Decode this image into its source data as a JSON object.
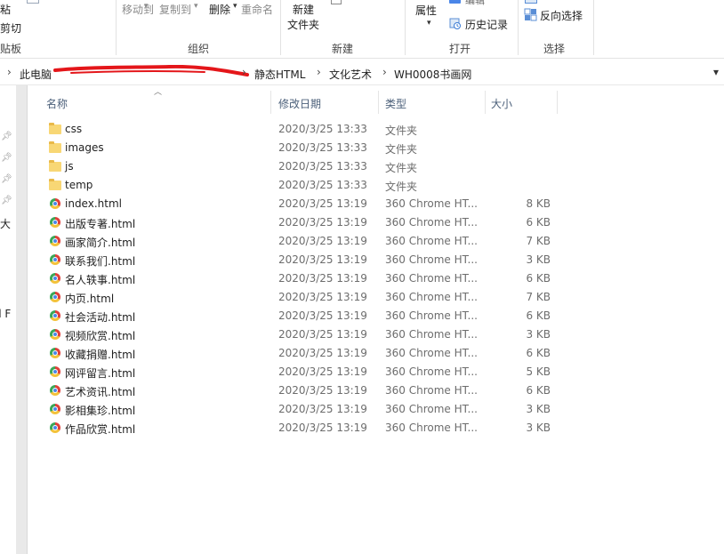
{
  "ribbon": {
    "clipboard": {
      "paste_clipped": "粘",
      "cut_clipped": "剪切",
      "group_clipped": "贴板"
    },
    "organize": {
      "move_to": "移动到",
      "copy_to": "复制到",
      "delete": "删除",
      "rename": "重命名",
      "group": "组织"
    },
    "new": {
      "new_folder_line1": "新建",
      "new_folder_line2": "文件夹",
      "group": "新建"
    },
    "open": {
      "properties": "属性",
      "edit_clipped": "编辑",
      "history": "历史记录",
      "group": "打开"
    },
    "select": {
      "invert": "反向选择",
      "group": "选择"
    }
  },
  "address": {
    "crumbs": [
      "此电脑",
      "静态HTML",
      "文化艺术",
      "WH0008书画网"
    ]
  },
  "columns": {
    "name": "名称",
    "date": "修改日期",
    "type": "类型",
    "size": "大小"
  },
  "nav": {
    "clip1": "大",
    "clip2": "d F"
  },
  "files": [
    {
      "name": "css",
      "date": "2020/3/25 13:33",
      "type": "文件夹",
      "size": "",
      "icon": "folder-icon"
    },
    {
      "name": "images",
      "date": "2020/3/25 13:33",
      "type": "文件夹",
      "size": "",
      "icon": "folder-icon"
    },
    {
      "name": "js",
      "date": "2020/3/25 13:33",
      "type": "文件夹",
      "size": "",
      "icon": "folder-icon"
    },
    {
      "name": "temp",
      "date": "2020/3/25 13:33",
      "type": "文件夹",
      "size": "",
      "icon": "folder-icon"
    },
    {
      "name": "index.html",
      "date": "2020/3/25 13:19",
      "type": "360 Chrome HT...",
      "size": "8 KB",
      "icon": "chrome-html-icon"
    },
    {
      "name": "出版专著.html",
      "date": "2020/3/25 13:19",
      "type": "360 Chrome HT...",
      "size": "6 KB",
      "icon": "chrome-html-icon"
    },
    {
      "name": "画家简介.html",
      "date": "2020/3/25 13:19",
      "type": "360 Chrome HT...",
      "size": "7 KB",
      "icon": "chrome-html-icon"
    },
    {
      "name": "联系我们.html",
      "date": "2020/3/25 13:19",
      "type": "360 Chrome HT...",
      "size": "3 KB",
      "icon": "chrome-html-icon"
    },
    {
      "name": "名人轶事.html",
      "date": "2020/3/25 13:19",
      "type": "360 Chrome HT...",
      "size": "6 KB",
      "icon": "chrome-html-icon"
    },
    {
      "name": "内页.html",
      "date": "2020/3/25 13:19",
      "type": "360 Chrome HT...",
      "size": "7 KB",
      "icon": "chrome-html-icon"
    },
    {
      "name": "社会活动.html",
      "date": "2020/3/25 13:19",
      "type": "360 Chrome HT...",
      "size": "6 KB",
      "icon": "chrome-html-icon"
    },
    {
      "name": "视频欣赏.html",
      "date": "2020/3/25 13:19",
      "type": "360 Chrome HT...",
      "size": "3 KB",
      "icon": "chrome-html-icon"
    },
    {
      "name": "收藏捐赠.html",
      "date": "2020/3/25 13:19",
      "type": "360 Chrome HT...",
      "size": "6 KB",
      "icon": "chrome-html-icon"
    },
    {
      "name": "网评留言.html",
      "date": "2020/3/25 13:19",
      "type": "360 Chrome HT...",
      "size": "5 KB",
      "icon": "chrome-html-icon"
    },
    {
      "name": "艺术资讯.html",
      "date": "2020/3/25 13:19",
      "type": "360 Chrome HT...",
      "size": "6 KB",
      "icon": "chrome-html-icon"
    },
    {
      "name": "影相集珍.html",
      "date": "2020/3/25 13:19",
      "type": "360 Chrome HT...",
      "size": "3 KB",
      "icon": "chrome-html-icon"
    },
    {
      "name": "作品欣赏.html",
      "date": "2020/3/25 13:19",
      "type": "360 Chrome HT...",
      "size": "3 KB",
      "icon": "chrome-html-icon"
    }
  ]
}
